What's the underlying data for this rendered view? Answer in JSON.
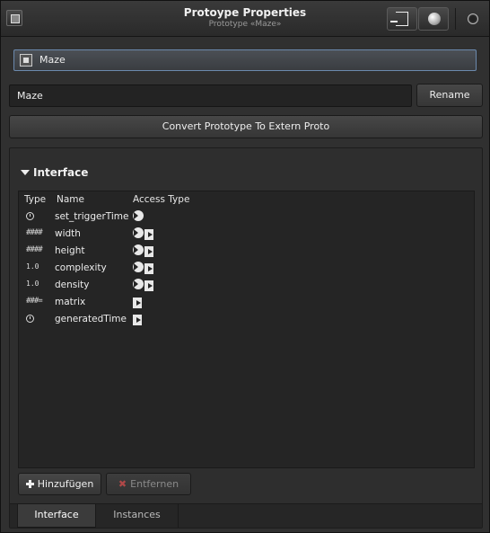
{
  "window": {
    "title": "Protoype Properties",
    "subtitle": "Prototype «Maze»"
  },
  "selector": {
    "label": "Maze"
  },
  "name_field": {
    "value": "Maze"
  },
  "buttons": {
    "rename": "Rename",
    "convert": "Convert Prototype To Extern Proto",
    "add": "Hinzufügen",
    "remove": "Entfernen"
  },
  "interface": {
    "header": "Interface",
    "columns": {
      "type": "Type",
      "name": "Name",
      "access": "Access Type"
    },
    "rows": [
      {
        "type_icon": "time-icon",
        "type_text": "",
        "name": "set_triggerTime",
        "access": "in"
      },
      {
        "type_icon": "int-icon",
        "type_text": "####",
        "name": "width",
        "access": "inout"
      },
      {
        "type_icon": "int-icon",
        "type_text": "####",
        "name": "height",
        "access": "inout"
      },
      {
        "type_icon": "float-icon",
        "type_text": "1.0",
        "name": "complexity",
        "access": "inout"
      },
      {
        "type_icon": "float-icon",
        "type_text": "1.0",
        "name": "density",
        "access": "inout"
      },
      {
        "type_icon": "int-array-icon",
        "type_text": "###=",
        "name": "matrix",
        "access": "out"
      },
      {
        "type_icon": "time-icon",
        "type_text": "",
        "name": "generatedTime",
        "access": "out"
      }
    ]
  },
  "tabs": [
    {
      "label": "Interface",
      "active": true
    },
    {
      "label": "Instances",
      "active": false
    }
  ]
}
